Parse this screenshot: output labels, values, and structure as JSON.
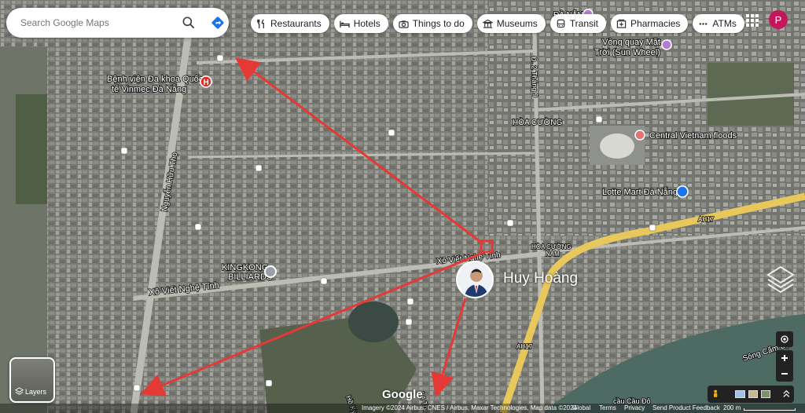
{
  "search": {
    "placeholder": "Search Google Maps"
  },
  "chips": [
    {
      "label": "Restaurants",
      "icon": "restaurant-icon"
    },
    {
      "label": "Hotels",
      "icon": "bed-icon"
    },
    {
      "label": "Things to do",
      "icon": "camera-icon"
    },
    {
      "label": "Museums",
      "icon": "museum-icon"
    },
    {
      "label": "Transit",
      "icon": "bus-icon"
    },
    {
      "label": "Pharmacies",
      "icon": "pharmacy-icon"
    },
    {
      "label": "ATMs",
      "icon": "more-dots-icon"
    }
  ],
  "account": {
    "initial": "P",
    "color": "#c2185b"
  },
  "map_labels": {
    "hospital_line1": "Bệnh viện Đa khoa Quốc",
    "hospital_line2": "tế Vinmec Đà Nẵng",
    "da_nang": "ĐÀ NẴNG",
    "sun_wheel_line1": "Vòng quay Mặt",
    "sun_wheel_line2": "Trời (Sun Wheel)",
    "hoa_cuong": "HÒA CƯỜNG",
    "central_vn": "Central Vietnam floods",
    "lotte": "Lotte Mart Đà Nẵng",
    "ah17": "AH17",
    "ah17_b": "AH17",
    "hoa_cuong_nam_1": "HÒA CƯỜNG",
    "hoa_cuong_nam_2": "NAM",
    "xo_viet_1": "Xô Viết Nghệ Tĩnh",
    "xo_viet_2": "Xô Viết Nghệ Tĩnh",
    "nguyen_huu_tho": "Nguyễn Hữu Thọ",
    "kingkong_1": "KINGKONG",
    "kingkong_2": "BILLIARDS",
    "street_2_9": "Đ. 2 Tháng 9",
    "song_cam_le": "Sông Cẩm Lệ",
    "cau_do": "cầu Cầu Đỏ",
    "ho_ky": "Hồ Kỳ",
    "le_thanh": "Lê Th"
  },
  "person": {
    "name": "Huy Hoàng"
  },
  "layers": {
    "label": "Layers"
  },
  "google_logo": "Google",
  "footer": {
    "imagery": "Imagery ©2024 Airbus, CNES / Airbus, Maxar Technologies, Map data ©2024",
    "global": "Global",
    "terms": "Terms",
    "privacy": "Privacy",
    "feedback": "Send Product Feedback",
    "scale": "200 m"
  },
  "colors": {
    "arrow": "#e53935",
    "road_yellow": "#e8c85a",
    "water": "#4d6a63"
  }
}
